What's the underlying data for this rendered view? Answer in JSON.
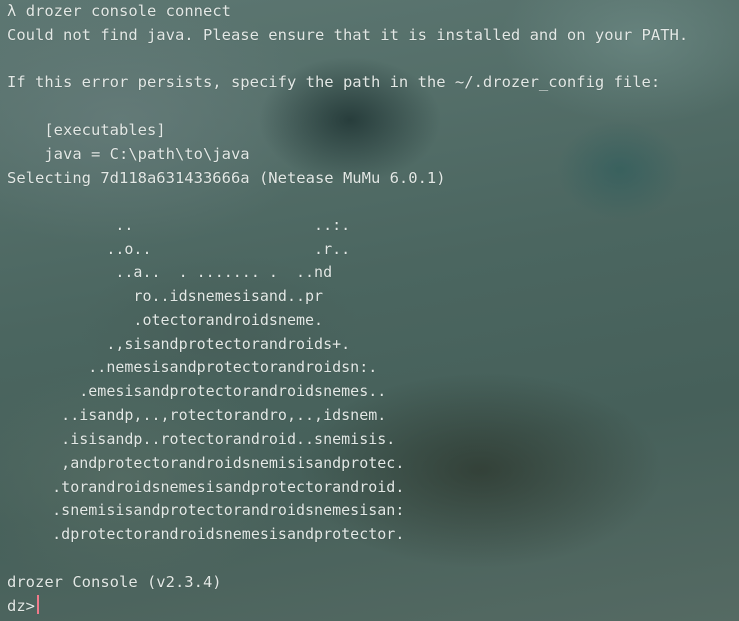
{
  "terminal": {
    "command_prompt": "λ",
    "command": "drozer console connect",
    "error_line": "Could not find java. Please ensure that it is installed and on your PATH.",
    "blank1": "",
    "persist_line": "If this error persists, specify the path in the ~/.drozer_config file:",
    "blank2": "",
    "config_section": "    [executables]",
    "config_java": "    java = C:\\path\\to\\java",
    "selecting_line": "Selecting 7d118a631433666a (Netease MuMu 6.0.1)",
    "blank3": "",
    "logo": [
      "            ..                    ..:.",
      "           ..o..                  .r..",
      "            ..a..  . ....... .  ..nd",
      "              ro..idsnemesisand..pr",
      "              .otectorandroidsneme.",
      "           .,sisandprotectorandroids+.",
      "         ..nemesisandprotectorandroidsn:.",
      "        .emesisandprotectorandroidsnemes..",
      "      ..isandp,..,rotectorandro,..,idsnem.",
      "      .isisandp..rotectorandroid..snemisis.",
      "      ,andprotectorandroidsnemisisandprotec.",
      "     .torandroidsnemesisandprotectorandroid.",
      "     .snemisisandprotectorandroidsnemesisan:",
      "     .dprotectorandroidsnemesisandprotector."
    ],
    "blank4": "",
    "version_line": "drozer Console (v2.3.4)",
    "input_prompt": "dz>"
  },
  "colors": {
    "text": "#e3e9e6",
    "cursor": "#f27a8b"
  }
}
